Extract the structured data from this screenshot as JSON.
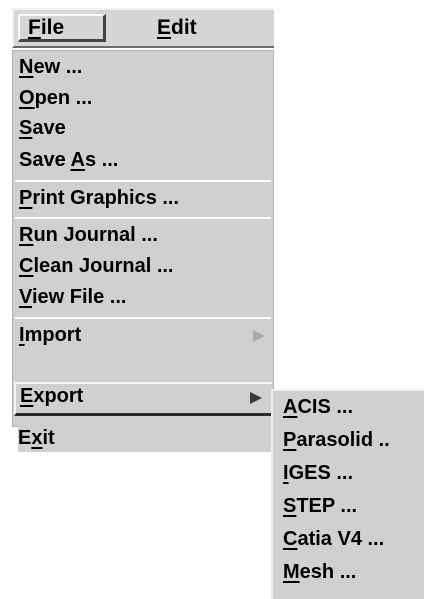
{
  "menubar": {
    "items": [
      {
        "pre": "",
        "mn": "F",
        "post": "ile"
      },
      {
        "pre": "",
        "mn": "E",
        "post": "dit"
      }
    ]
  },
  "file_menu": {
    "items": [
      {
        "pre": "",
        "mn": "N",
        "post": "ew ..."
      },
      {
        "pre": "",
        "mn": "O",
        "post": "pen ..."
      },
      {
        "pre": "",
        "mn": "S",
        "post": "ave"
      },
      {
        "pre": "Save ",
        "mn": "A",
        "post": "s ..."
      },
      {
        "pre": "",
        "mn": "P",
        "post": "rint Graphics ..."
      },
      {
        "pre": "",
        "mn": "R",
        "post": "un Journal ..."
      },
      {
        "pre": "",
        "mn": "C",
        "post": "lean Journal ..."
      },
      {
        "pre": "",
        "mn": "V",
        "post": "iew File ..."
      },
      {
        "pre": "",
        "mn": "I",
        "post": "mport"
      },
      {
        "pre": "",
        "mn": "E",
        "post": "xport"
      },
      {
        "pre": "E",
        "mn": "x",
        "post": "it"
      }
    ]
  },
  "export_submenu": {
    "items": [
      {
        "pre": "",
        "mn": "A",
        "post": "CIS ..."
      },
      {
        "pre": "",
        "mn": "P",
        "post": "arasolid .."
      },
      {
        "pre": "",
        "mn": "I",
        "post": "GES ..."
      },
      {
        "pre": "",
        "mn": "S",
        "post": "TEP ..."
      },
      {
        "pre": "",
        "mn": "C",
        "post": "atia V4 ..."
      },
      {
        "pre": "",
        "mn": "M",
        "post": "esh ..."
      }
    ]
  },
  "colors": {
    "menu_bg": "#d0d0d0",
    "highlight": "#ffffff",
    "shadow": "#2c2c2c",
    "text": "#000000"
  }
}
